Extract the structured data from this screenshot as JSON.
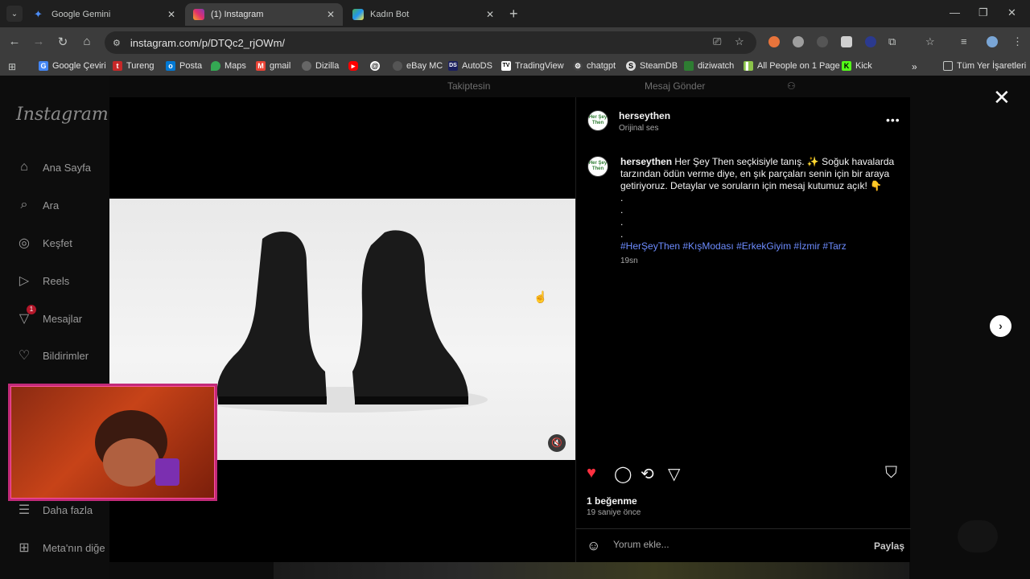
{
  "browser": {
    "tabs": [
      {
        "title": "Google Gemini",
        "active": false,
        "color": "#4c8df6"
      },
      {
        "title": "(1) Instagram",
        "active": true,
        "color": "#e1306c"
      },
      {
        "title": "Kadın Bot",
        "active": false,
        "color": "#4caf50"
      }
    ],
    "url": "instagram.com/p/DTQc2_rjOWm/",
    "bookmarks": [
      "Google Çeviri",
      "Tureng",
      "Posta",
      "Maps",
      "gmail",
      "Dizilla",
      "",
      "",
      "eBay MC",
      "AutoDS",
      "TradingView",
      "chatgpt",
      "SteamDB",
      "diziwatch",
      "All People on 1 Page",
      "Kick"
    ],
    "bookmarks_folder": "Tüm Yer İşaretleri"
  },
  "instagram": {
    "logo": "Instagram",
    "under_header": {
      "following": "Takiptesin",
      "message": "Mesaj Gönder"
    },
    "nav": [
      {
        "label": "Ana Sayfa",
        "icon": "home-icon"
      },
      {
        "label": "Ara",
        "icon": "search-icon"
      },
      {
        "label": "Keşfet",
        "icon": "compass-icon"
      },
      {
        "label": "Reels",
        "icon": "reels-icon"
      },
      {
        "label": "Mesajlar",
        "icon": "messenger-icon",
        "badge": "1"
      },
      {
        "label": "Bildirimler",
        "icon": "heart-icon"
      },
      {
        "label": "Daha fazla",
        "icon": "menu-icon"
      },
      {
        "label": "Meta'nın diğe",
        "icon": "meta-apps-icon"
      }
    ],
    "post": {
      "username": "herseythen",
      "audio": "Orijinal ses",
      "avatar_text": "Her Şey Then",
      "caption_user": "herseythen",
      "caption_text": "Her Şey Then seçkisiyle tanış. ✨ Soğuk havalarda tarzından ödün verme diye, en şık parçaları senin için bir araya getiriyoruz. Detaylar ve soruların için mesaj kutumuz açık! 👇",
      "caption_dots": [
        ".",
        ".",
        ".",
        "."
      ],
      "hashtags": "#HerŞeyThen #KışModası #ErkekGiyim #İzmir #Tarz",
      "caption_time": "19sn",
      "likes": "1 beğenme",
      "posted_ago": "19 saniye önce",
      "comment_placeholder": "Yorum ekle...",
      "share_label": "Paylaş"
    }
  }
}
